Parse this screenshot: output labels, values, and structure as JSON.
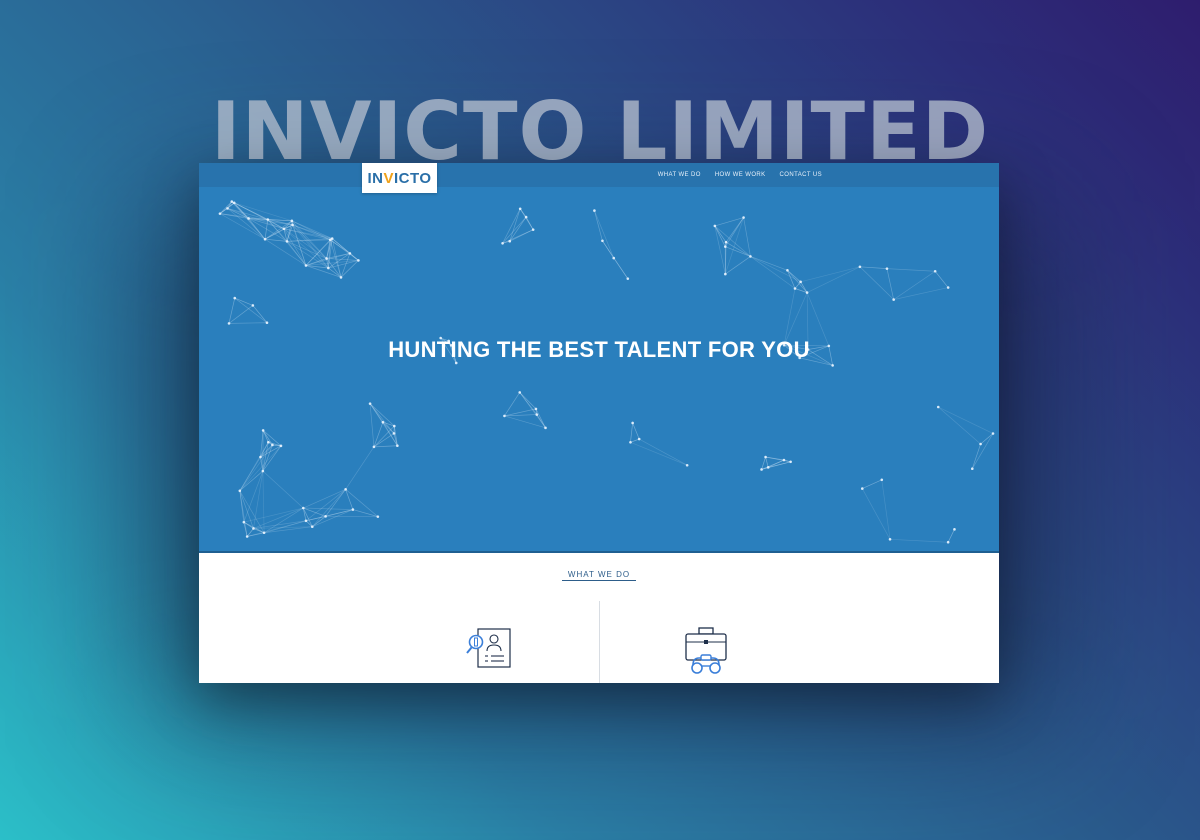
{
  "showcase": {
    "title": "INVICTO LIMITED"
  },
  "logo": {
    "prefix": "IN",
    "accent": "V",
    "suffix": "ICTO"
  },
  "nav": {
    "items": [
      {
        "label": "WHAT WE DO"
      },
      {
        "label": "HOW WE WORK"
      },
      {
        "label": "CONTACT US"
      }
    ]
  },
  "hero": {
    "headline": "HUNTING THE BEST TALENT FOR YOU"
  },
  "section": {
    "title": "WHAT WE DO"
  },
  "icons": [
    "recruitment-search-icon",
    "briefcase-binoculars-icon"
  ],
  "colors": {
    "nav_bg": "#2873ad",
    "hero_bg": "#2a7fbd",
    "logo_text": "#2a6fa8",
    "logo_accent": "#f0a21a",
    "section_title": "#2d5d8a"
  }
}
